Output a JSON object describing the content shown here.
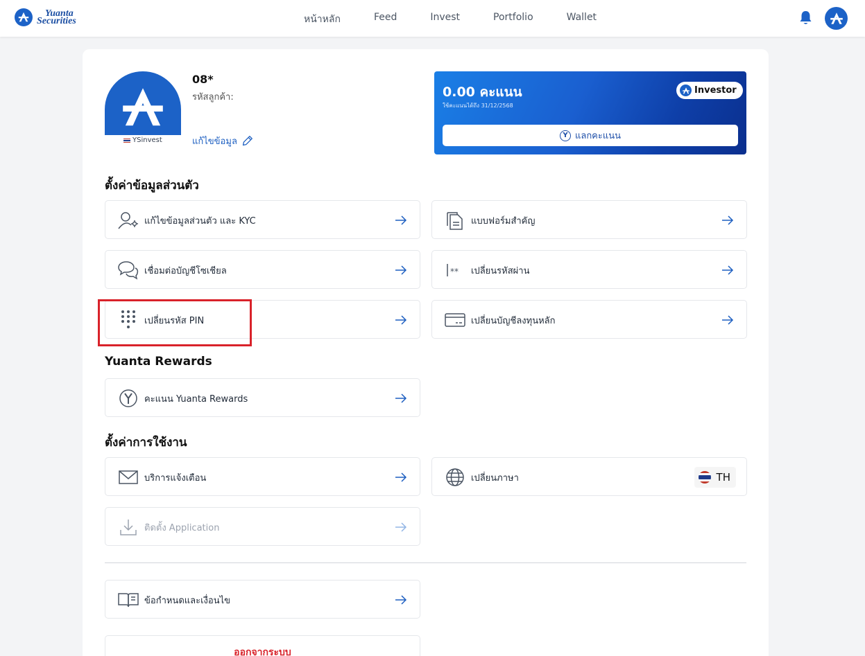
{
  "header": {
    "logo_line1": "Yuanta",
    "logo_line2": "Securities",
    "nav": [
      "หน้าหลัก",
      "Feed",
      "Invest",
      "Portfolio",
      "Wallet"
    ]
  },
  "profile": {
    "avatar_caption": "YSinvest",
    "user_id": "08*",
    "customer_label": "รหัสลูกค้า:",
    "edit_label": "แก้ไขข้อมูล"
  },
  "points_card": {
    "points": "0.00 คะแนน",
    "expiry": "ใช้คะแนนได้ถึง 31/12/2568",
    "tier": "Investor",
    "redeem_label": "แลกคะแนน",
    "redeem_icon_letter": "Y"
  },
  "sections": {
    "personal": "ตั้งค่าข้อมูลส่วนตัว",
    "rewards": "Yuanta Rewards",
    "usage": "ตั้งค่าการใช้งาน"
  },
  "items": {
    "edit_kyc": "แก้ไขข้อมูลส่วนตัว และ KYC",
    "forms": "แบบฟอร์มสำคัญ",
    "social": "เชื่อมต่อบัญชีโซเชียล",
    "password": "เปลี่ยนรหัสผ่าน",
    "pin": "เปลี่ยนรหัส PIN",
    "bank": "เปลี่ยนบัญชีลงทุนหลัก",
    "rewards_points": "คะแนน Yuanta Rewards",
    "notifications": "บริการแจ้งเตือน",
    "language": "เปลี่ยนภาษา",
    "language_value": "TH",
    "install_app": "ติดตั้ง Application",
    "terms": "ข้อกำหนดและเงื่อนไข"
  },
  "logout_label": "ออกจากระบบ",
  "colors": {
    "brand": "#1c62c7",
    "link": "#1d5fc1",
    "danger": "#d9222a"
  }
}
